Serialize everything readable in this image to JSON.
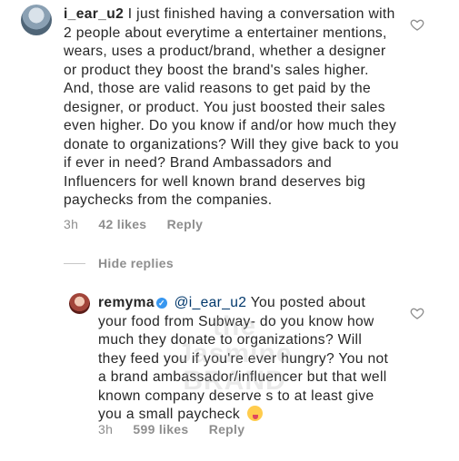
{
  "comment1": {
    "username": "i_ear_u2",
    "text": "I just finished having a conversation with 2 people about everytime a entertainer mentions, wears, uses a product/brand, whether a designer or product they boost the brand's sales higher. And, those are valid reasons to get paid by the designer, or product. You just boosted their sales even higher. Do you know if and/or how much they donate to organizations? Will they give back to you if ever in need? Brand Ambassadors and Influencers for well known brand deserves big paychecks from the companies.",
    "time": "3h",
    "likes": "42 likes",
    "reply": "Reply"
  },
  "hide_replies": "Hide replies",
  "comment2": {
    "username": "remyma",
    "verified_mark": "✓",
    "mention": "@i_ear_u2",
    "text": "You posted about your food from Subway- do you know how much they donate to organizations? Will they feed you if you're ever hungry? You not a brand ambassador/influencer but that well known company deserve s to at least give you a small paycheck",
    "emoji": "zany-face-emoji",
    "time": "3h",
    "likes": "599 likes",
    "reply": "Reply"
  },
  "watermark": "the Jasmine BRAND",
  "icons": {
    "like": "heart-outline-icon"
  },
  "colors": {
    "meta": "#8e8e8e",
    "mention": "#00376b",
    "verified": "#3897f0"
  }
}
